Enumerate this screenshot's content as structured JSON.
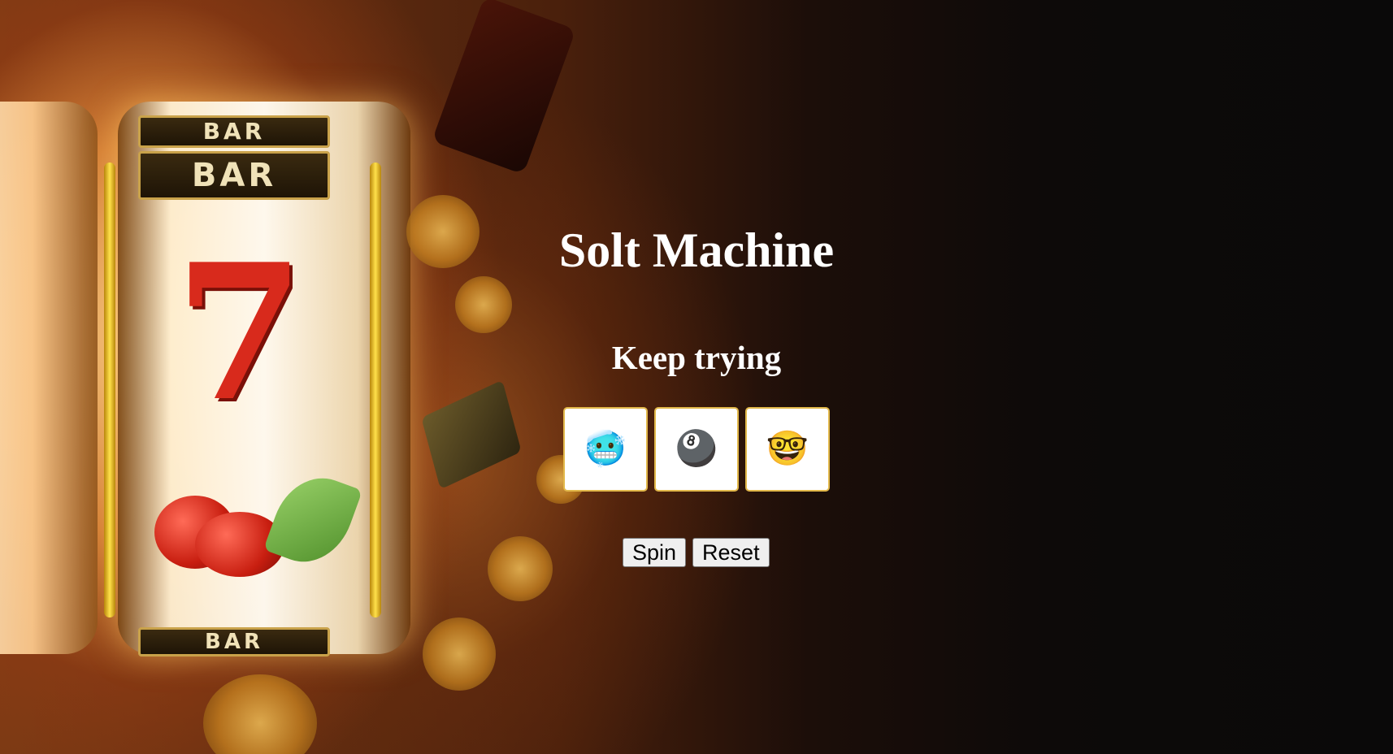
{
  "page": {
    "title": "Solt Machine",
    "status_message": "Keep trying"
  },
  "slots": [
    {
      "symbol": "🥶",
      "icon": "cold-face-icon"
    },
    {
      "symbol": "🎱",
      "icon": "pool-8-ball-icon"
    },
    {
      "symbol": "🤓",
      "icon": "nerd-face-icon"
    }
  ],
  "controls": {
    "spin_label": "Spin",
    "reset_label": "Reset"
  },
  "background": {
    "image": "casino-slot-machine-background"
  }
}
